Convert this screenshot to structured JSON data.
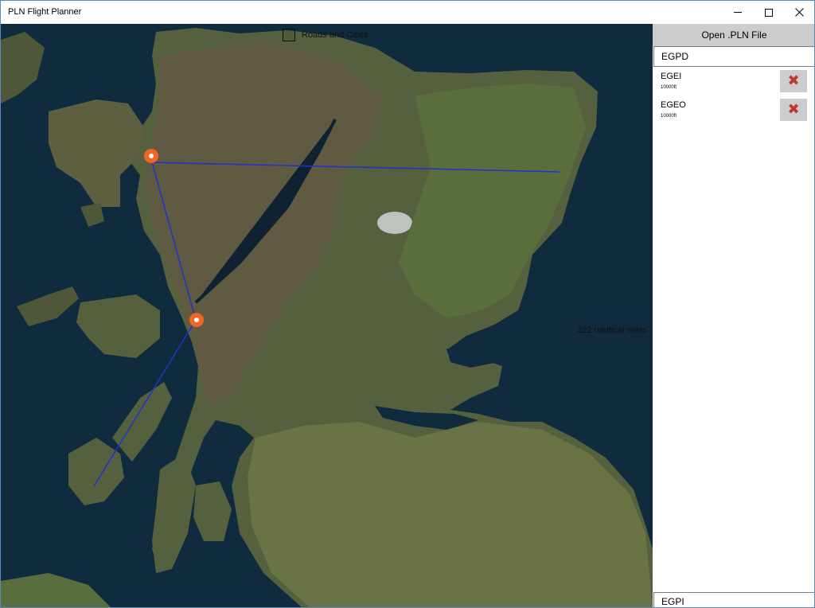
{
  "window": {
    "title": "PLN Flight Planner"
  },
  "map": {
    "overlay_toggle_label": "Roads and Cities",
    "overlay_toggle_checked": false,
    "distance_text": "222 nautical miles",
    "route_color": "#2233cc",
    "marker_color": "#f26522",
    "marker_icons": [
      "map-marker-icon",
      "map-marker-icon"
    ]
  },
  "panel": {
    "open_button_label": "Open .PLN File",
    "departure_value": "EGPD",
    "waypoints": [
      {
        "name": "EGEI",
        "altitude": "10000ft"
      },
      {
        "name": "EGEO",
        "altitude": "10000ft"
      }
    ],
    "delete_icon": "close-icon",
    "destination_value": "EGPI"
  }
}
